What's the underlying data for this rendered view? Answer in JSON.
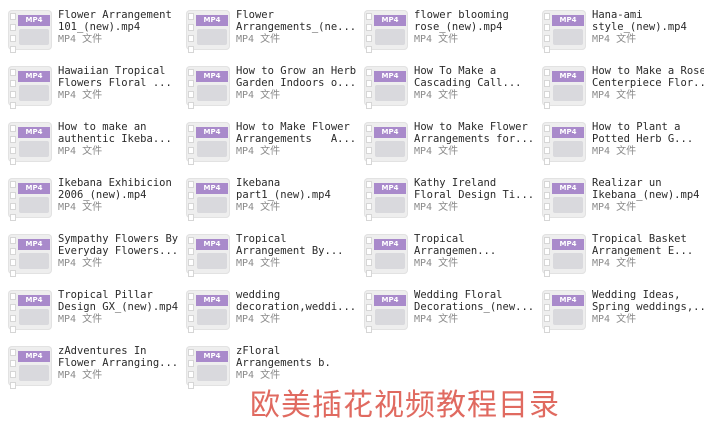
{
  "files": [
    {
      "name": "Flower Arrangement\n101_(new).mp4",
      "type": "MP4 文件"
    },
    {
      "name": "Flower\nArrangements_(ne...",
      "type": "MP4 文件"
    },
    {
      "name": "flower blooming\nrose_(new).mp4",
      "type": "MP4 文件"
    },
    {
      "name": "Hana-ami\nstyle_(new).mp4",
      "type": "MP4 文件"
    },
    {
      "name": "Hawaiian Tropical\nFlowers Floral ...",
      "type": "MP4 文件"
    },
    {
      "name": "How to Grow an Herb\nGarden Indoors o...",
      "type": "MP4 文件"
    },
    {
      "name": "How To Make a\nCascading Call...",
      "type": "MP4 文件"
    },
    {
      "name": "How to Make a Rose\nCenterpiece Flor...",
      "type": "MP4 文件"
    },
    {
      "name": "How to make an\nauthentic Ikeba...",
      "type": "MP4 文件"
    },
    {
      "name": "How to Make Flower\nArrangements   A...",
      "type": "MP4 文件"
    },
    {
      "name": "How to Make Flower\nArrangements for...",
      "type": "MP4 文件"
    },
    {
      "name": "How to Plant a\nPotted Herb G...",
      "type": "MP4 文件"
    },
    {
      "name": "Ikebana Exhibicion\n2006_(new).mp4",
      "type": "MP4 文件"
    },
    {
      "name": "Ikebana\npart1_(new).mp4",
      "type": "MP4 文件"
    },
    {
      "name": "Kathy Ireland\nFloral Design Ti...",
      "type": "MP4 文件"
    },
    {
      "name": "Realizar un\nIkebana_(new).mp4",
      "type": "MP4 文件"
    },
    {
      "name": "Sympathy Flowers By\nEveryday Flowers...",
      "type": "MP4 文件"
    },
    {
      "name": "Tropical\nArrangement By...",
      "type": "MP4 文件"
    },
    {
      "name": "Tropical\nArrangemen...",
      "type": "MP4 文件"
    },
    {
      "name": "Tropical Basket\nArrangement E...",
      "type": "MP4 文件"
    },
    {
      "name": "Tropical Pillar\nDesign GX_(new).mp4",
      "type": "MP4 文件"
    },
    {
      "name": "wedding\ndecoration,weddi...",
      "type": "MP4 文件"
    },
    {
      "name": "Wedding Floral\nDecorations_(new...",
      "type": "MP4 文件"
    },
    {
      "name": "Wedding Ideas,\nSpring weddings,...",
      "type": "MP4 文件"
    },
    {
      "name": "zAdventures In\nFlower Arranging...",
      "type": "MP4 文件"
    },
    {
      "name": "zFloral\nArrangements b.",
      "type": "MP4 文件"
    }
  ],
  "icon_badge": "MP4",
  "icon_name": "mp4-file-icon",
  "watermark": "欧美插花视频教程目录",
  "colors": {
    "badge": "#a98acb",
    "watermark": "#e06a60"
  }
}
